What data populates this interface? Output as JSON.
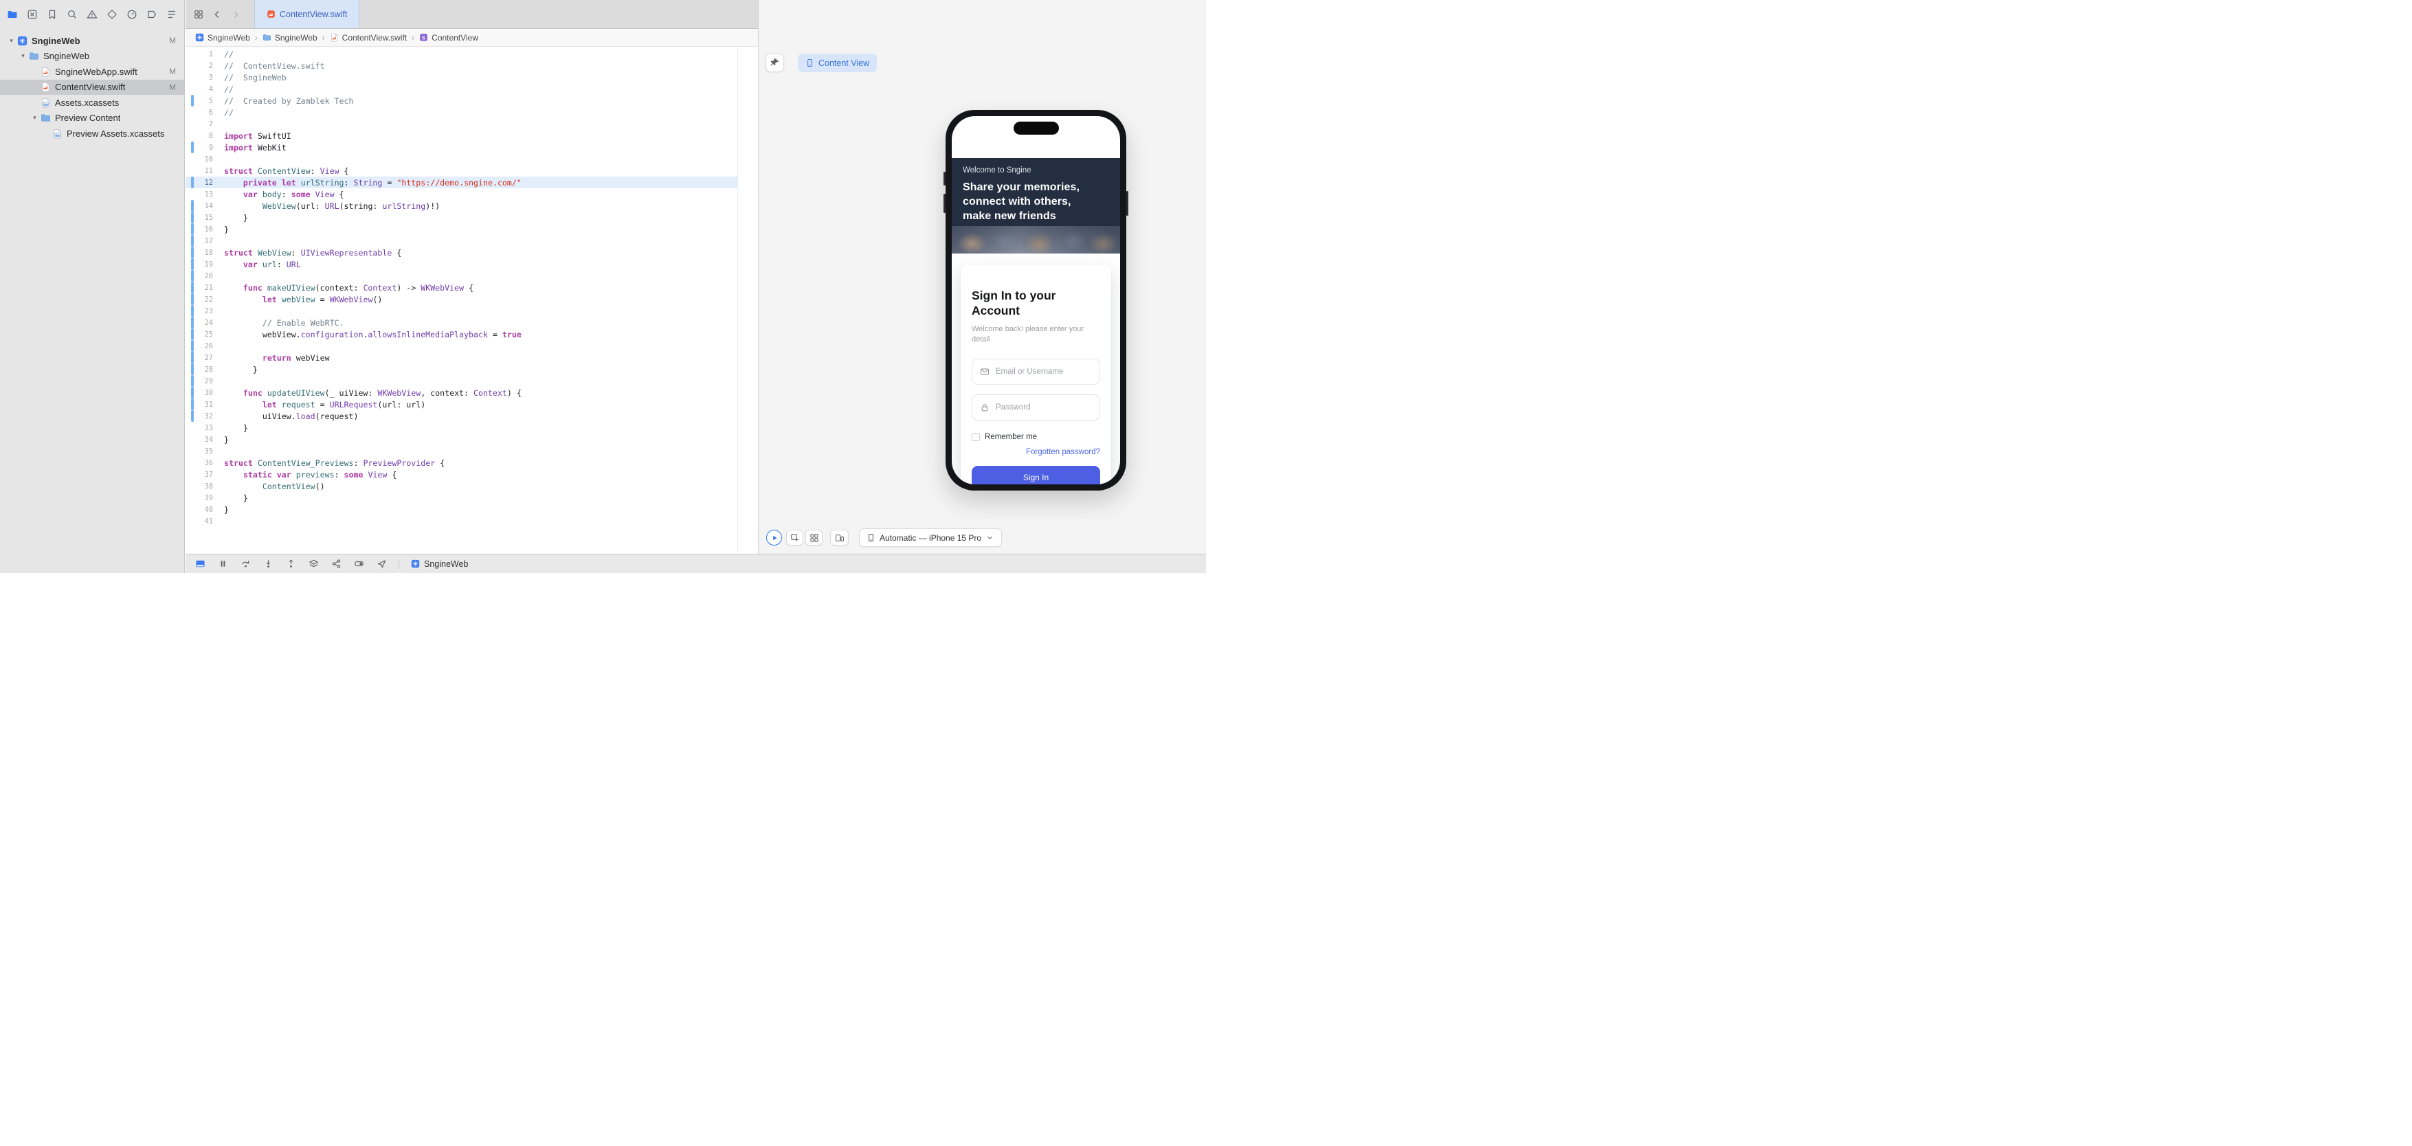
{
  "colors": {
    "accent_blue": "#3478f6",
    "tab_tint": "#d8e4f8",
    "line_highlight": "#e3eefc",
    "keyword_pink": "#ad3da4",
    "string_red": "#d12f1b",
    "type_purple": "#703daa",
    "decl_teal": "#326d74",
    "comment_gray": "#707f8c",
    "preview_header_navy": "#232e40",
    "signin_button_blue": "#4d5fe3",
    "link_blue": "#4a66e8"
  },
  "navigator": {
    "rail_icons": [
      {
        "name": "project-navigator",
        "active": true
      },
      {
        "name": "source-control-navigator"
      },
      {
        "name": "bookmarks-navigator"
      },
      {
        "name": "find-navigator"
      },
      {
        "name": "issues-navigator"
      },
      {
        "name": "tests-navigator"
      },
      {
        "name": "debug-navigator"
      },
      {
        "name": "breakpoints-navigator"
      },
      {
        "name": "reports-navigator"
      }
    ],
    "tree": [
      {
        "label": "SngineWeb",
        "icon": "project",
        "level": 0,
        "expandable": true,
        "badge": "M"
      },
      {
        "label": "SngineWeb",
        "icon": "folder",
        "level": 1,
        "expandable": true
      },
      {
        "label": "SngineWebApp.swift",
        "icon": "swift",
        "level": 2,
        "badge": "M"
      },
      {
        "label": "ContentView.swift",
        "icon": "swift",
        "level": 2,
        "badge": "M",
        "selected": true
      },
      {
        "label": "Assets.xcassets",
        "icon": "assets",
        "level": 2
      },
      {
        "label": "Preview Content",
        "icon": "folder",
        "level": 2,
        "expandable": true
      },
      {
        "label": "Preview Assets.xcassets",
        "icon": "assets",
        "level": 3
      }
    ]
  },
  "tab_bar": {
    "active_tab": "ContentView.swift"
  },
  "breadcrumb": [
    {
      "icon": "project",
      "label": "SngineWeb"
    },
    {
      "icon": "folder",
      "label": "SngineWeb"
    },
    {
      "icon": "swift",
      "label": "ContentView.swift"
    },
    {
      "icon": "struct",
      "label": "ContentView"
    }
  ],
  "editor": {
    "current_line": 12,
    "changed_lines": [
      5,
      9,
      12,
      [
        14,
        32
      ]
    ],
    "lines": [
      [
        [
          "com",
          "//"
        ]
      ],
      [
        [
          "com",
          "//  ContentView.swift"
        ]
      ],
      [
        [
          "com",
          "//  SngineWeb"
        ]
      ],
      [
        [
          "com",
          "//"
        ]
      ],
      [
        [
          "com",
          "//  Created by Zamblek Tech"
        ]
      ],
      [
        [
          "com",
          "//"
        ]
      ],
      [],
      [
        [
          "kw",
          "import"
        ],
        [
          "pl",
          " SwiftUI"
        ]
      ],
      [
        [
          "kw",
          "import"
        ],
        [
          "pl",
          " WebKit"
        ]
      ],
      [],
      [
        [
          "kw",
          "struct"
        ],
        [
          "pl",
          " "
        ],
        [
          "decl",
          "ContentView"
        ],
        [
          "pl",
          ": "
        ],
        [
          "type",
          "View"
        ],
        [
          "pl",
          " {"
        ]
      ],
      [
        [
          "pl",
          "    "
        ],
        [
          "kw",
          "private"
        ],
        [
          "pl",
          " "
        ],
        [
          "kw",
          "let"
        ],
        [
          "pl",
          " "
        ],
        [
          "decl",
          "urlString"
        ],
        [
          "pl",
          ": "
        ],
        [
          "type",
          "String"
        ],
        [
          "pl",
          " = "
        ],
        [
          "str",
          "\"https://demo.sngine.com/\""
        ]
      ],
      [
        [
          "pl",
          "    "
        ],
        [
          "kw",
          "var"
        ],
        [
          "pl",
          " "
        ],
        [
          "decl",
          "body"
        ],
        [
          "pl",
          ": "
        ],
        [
          "kw",
          "some"
        ],
        [
          "pl",
          " "
        ],
        [
          "type",
          "View"
        ],
        [
          "pl",
          " {"
        ]
      ],
      [
        [
          "pl",
          "        "
        ],
        [
          "decl",
          "WebView"
        ],
        [
          "pl",
          "(url: "
        ],
        [
          "type",
          "URL"
        ],
        [
          "pl",
          "(string: "
        ],
        [
          "type",
          "urlString"
        ],
        [
          "pl",
          ")!)"
        ]
      ],
      [
        [
          "pl",
          "    }"
        ]
      ],
      [
        [
          "pl",
          "}"
        ]
      ],
      [],
      [
        [
          "kw",
          "struct"
        ],
        [
          "pl",
          " "
        ],
        [
          "decl",
          "WebView"
        ],
        [
          "pl",
          ": "
        ],
        [
          "type",
          "UIViewRepresentable"
        ],
        [
          "pl",
          " {"
        ]
      ],
      [
        [
          "pl",
          "    "
        ],
        [
          "kw",
          "var"
        ],
        [
          "pl",
          " "
        ],
        [
          "decl",
          "url"
        ],
        [
          "pl",
          ": "
        ],
        [
          "type",
          "URL"
        ]
      ],
      [],
      [
        [
          "pl",
          "    "
        ],
        [
          "kw",
          "func"
        ],
        [
          "pl",
          " "
        ],
        [
          "decl",
          "makeUIView"
        ],
        [
          "pl",
          "(context: "
        ],
        [
          "type",
          "Context"
        ],
        [
          "pl",
          ") -> "
        ],
        [
          "type",
          "WKWebView"
        ],
        [
          "pl",
          " {"
        ]
      ],
      [
        [
          "pl",
          "        "
        ],
        [
          "kw",
          "let"
        ],
        [
          "pl",
          " "
        ],
        [
          "decl",
          "webView"
        ],
        [
          "pl",
          " = "
        ],
        [
          "type",
          "WKWebView"
        ],
        [
          "pl",
          "()"
        ]
      ],
      [],
      [
        [
          "pl",
          "        "
        ],
        [
          "com",
          "// Enable WebRTC."
        ]
      ],
      [
        [
          "pl",
          "        webView."
        ],
        [
          "type",
          "configuration"
        ],
        [
          "pl",
          "."
        ],
        [
          "type",
          "allowsInlineMediaPlayback"
        ],
        [
          "pl",
          " = "
        ],
        [
          "kw",
          "true"
        ]
      ],
      [],
      [
        [
          "pl",
          "        "
        ],
        [
          "kw",
          "return"
        ],
        [
          "pl",
          " webView"
        ]
      ],
      [
        [
          "pl",
          "      }"
        ]
      ],
      [],
      [
        [
          "pl",
          "    "
        ],
        [
          "kw",
          "func"
        ],
        [
          "pl",
          " "
        ],
        [
          "decl",
          "updateUIView"
        ],
        [
          "pl",
          "(_ uiView: "
        ],
        [
          "type",
          "WKWebView"
        ],
        [
          "pl",
          ", context: "
        ],
        [
          "type",
          "Context"
        ],
        [
          "pl",
          ") {"
        ]
      ],
      [
        [
          "pl",
          "        "
        ],
        [
          "kw",
          "let"
        ],
        [
          "pl",
          " "
        ],
        [
          "decl",
          "request"
        ],
        [
          "pl",
          " = "
        ],
        [
          "type",
          "URLRequest"
        ],
        [
          "pl",
          "(url: url)"
        ]
      ],
      [
        [
          "pl",
          "        uiView."
        ],
        [
          "type",
          "load"
        ],
        [
          "pl",
          "(request)"
        ]
      ],
      [
        [
          "pl",
          "    }"
        ]
      ],
      [
        [
          "pl",
          "}"
        ]
      ],
      [],
      [
        [
          "kw",
          "struct"
        ],
        [
          "pl",
          " "
        ],
        [
          "decl",
          "ContentView_Previews"
        ],
        [
          "pl",
          ": "
        ],
        [
          "type",
          "PreviewProvider"
        ],
        [
          "pl",
          " {"
        ]
      ],
      [
        [
          "pl",
          "    "
        ],
        [
          "kw",
          "static"
        ],
        [
          "pl",
          " "
        ],
        [
          "kw",
          "var"
        ],
        [
          "pl",
          " "
        ],
        [
          "decl",
          "previews"
        ],
        [
          "pl",
          ": "
        ],
        [
          "kw",
          "some"
        ],
        [
          "pl",
          " "
        ],
        [
          "type",
          "View"
        ],
        [
          "pl",
          " {"
        ]
      ],
      [
        [
          "pl",
          "        "
        ],
        [
          "decl",
          "ContentView"
        ],
        [
          "pl",
          "()"
        ]
      ],
      [
        [
          "pl",
          "    }"
        ]
      ],
      [
        [
          "pl",
          "}"
        ]
      ],
      []
    ]
  },
  "canvas": {
    "chip_label": "Content View",
    "device_picker_label": "Automatic — iPhone 15 Pro",
    "preview_app": {
      "welcome": "Welcome to Sngine",
      "tagline": "Share your memories,\nconnect with others,\nmake new friends",
      "signin_title": "Sign In to your\nAccount",
      "signin_subtitle": "Welcome back! please enter your detail",
      "email_placeholder": "Email or Username",
      "password_placeholder": "Password",
      "remember_label": "Remember me",
      "forgot_link": "Forgotten password?",
      "signin_button": "Sign In"
    }
  },
  "debug_bar": {
    "scheme_label": "SngineWeb"
  }
}
